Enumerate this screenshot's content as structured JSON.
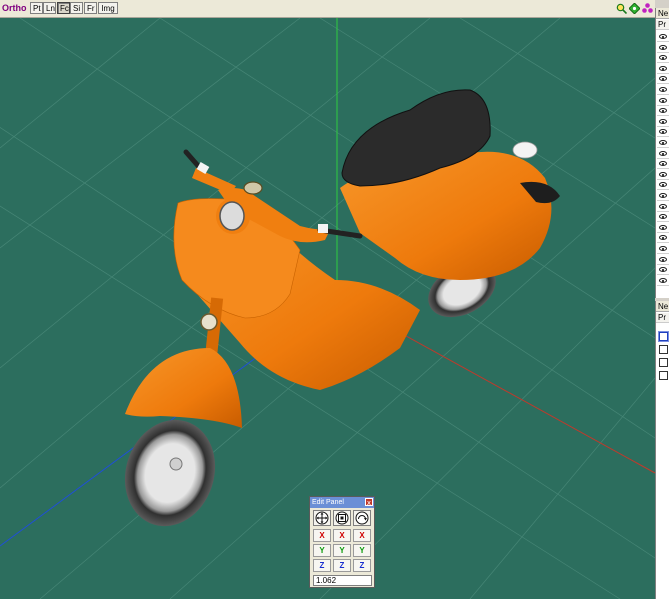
{
  "toolbar": {
    "mode_label": "Ortho",
    "buttons": [
      "Pt",
      "Ln",
      "Fc",
      "Si",
      "Fr",
      "Img"
    ],
    "active_button": "Fc",
    "right_icons": [
      "zoom-icon",
      "pan-icon",
      "orbit-icon"
    ]
  },
  "colors": {
    "viewport_bg": "#2c6e5e",
    "body_orange": "#f07f10",
    "seat": "#2b2b2b",
    "axis_x": "#c0392b",
    "axis_y": "#2ecc40",
    "axis_z": "#1f4fd6"
  },
  "right_panel_top": {
    "header": "Ne",
    "subheader": "Pr",
    "row_count": 24,
    "row_icon": "eye-icon"
  },
  "right_panel_bottom": {
    "header": "Ne",
    "subheader": "Pr",
    "checkbox_count": 4
  },
  "edit_panel": {
    "title": "Edit Panel",
    "close_label": "x",
    "tools": [
      "move-tool-icon",
      "scale-tool-icon",
      "rotate-tool-icon"
    ],
    "axis_rows": [
      [
        "X",
        "X",
        "X"
      ],
      [
        "Y",
        "Y",
        "Y"
      ],
      [
        "Z",
        "Z",
        "Z"
      ]
    ],
    "value": "1.062"
  }
}
